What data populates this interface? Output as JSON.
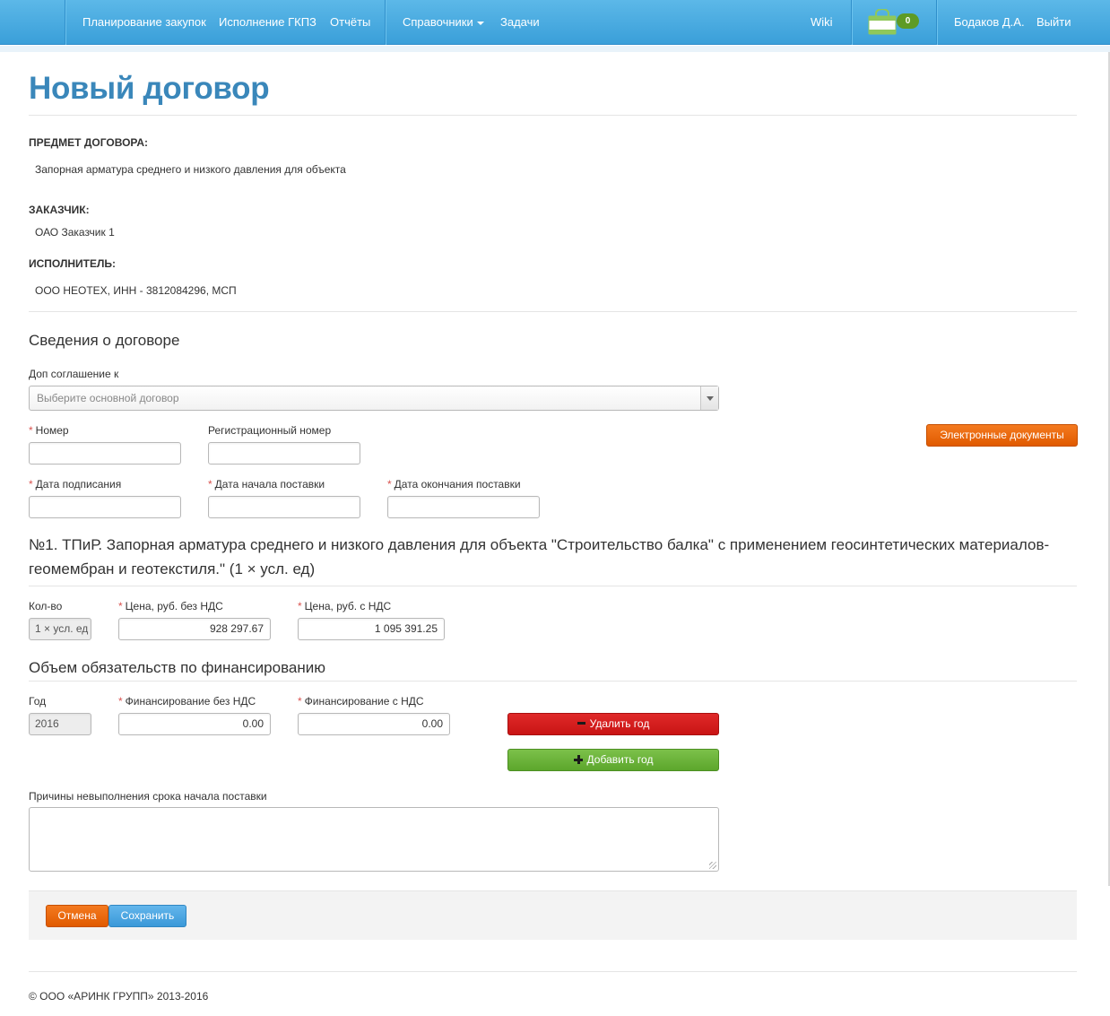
{
  "nav": {
    "items": [
      "Планирование закупок",
      "Исполнение ГКПЗ",
      "Отчёты"
    ],
    "directories": "Справочники",
    "tasks": "Задачи",
    "wiki": "Wiki",
    "cart_count": "0",
    "cart_icon": "shopping-bag-icon",
    "user": "Бодаков Д.А.",
    "logout": "Выйти",
    "color": "#3a9fd9"
  },
  "page": {
    "title": "Новый договор",
    "subject_label": "ПРЕДМЕТ ДОГОВОРА:",
    "subject_value": "Запорная арматура среднего и низкого давления для объекта",
    "customer_label": "ЗАКАЗЧИК:",
    "customer_value": "ОАО Заказчик 1",
    "contractor_label": "ИСПОЛНИТЕЛЬ:",
    "contractor_value": "ООО НЕОТЕХ, ИНН - 3812084296, МСП"
  },
  "contract": {
    "heading": "Сведения о договоре",
    "addendum_label": "Доп соглашение к",
    "addendum_placeholder": "Выберите основной договор",
    "number_label": "Номер",
    "reg_number_label": "Регистрационный номер",
    "edocs_button": "Электронные документы",
    "sign_date_label": "Дата подписания",
    "delivery_start_label": "Дата начала поставки",
    "delivery_end_label": "Дата окончания поставки"
  },
  "item": {
    "title": "№1. ТПиР. Запорная арматура среднего и низкого давления для объекта \"Строительство  балка\" с применением геосинтетических материалов-геомембран и геотекстиля.\" (1 × усл. ед)",
    "qty_label": "Кол-во",
    "qty_value": "1 × усл. ед",
    "price_no_vat_label": "Цена, руб. без НДС",
    "price_no_vat_value": "928 297.67",
    "price_vat_label": "Цена, руб. с НДС",
    "price_vat_value": "1 095 391.25"
  },
  "financing": {
    "heading": "Объем обязательств по финансированию",
    "year_label": "Год",
    "year_value": "2016",
    "fin_no_vat_label": "Финансирование без НДС",
    "fin_no_vat_value": "0.00",
    "fin_vat_label": "Финансирование с НДС",
    "fin_vat_value": "0.00",
    "delete_year": "Удалить год",
    "add_year": "Добавить год"
  },
  "reasons": {
    "label": "Причины невыполнения срока начала поставки",
    "value": ""
  },
  "actions": {
    "cancel": "Отмена",
    "save": "Сохранить"
  },
  "footer": {
    "copyright": "© ООО «АРИНК ГРУПП» 2013-2016"
  }
}
